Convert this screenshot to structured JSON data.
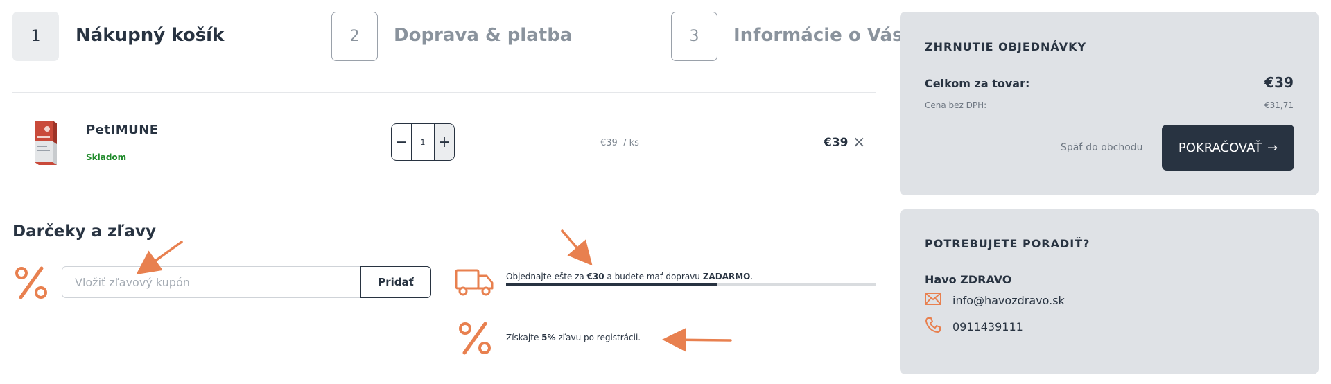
{
  "steps": [
    {
      "number": "1",
      "label": "Nákupný košík"
    },
    {
      "number": "2",
      "label": "Doprava & platba"
    },
    {
      "number": "3",
      "label": "Informácie o Vás"
    }
  ],
  "cart": {
    "item": {
      "name": "PetIMUNE",
      "stock": "Skladom",
      "quantity": "1",
      "unit_price": "€39",
      "unit": "/ ks",
      "total": "€39"
    }
  },
  "gifts": {
    "title": "Darčeky a zľavy",
    "coupon_placeholder": "Vložiť zľavový kupón",
    "coupon_button": "Pridať",
    "shipping": {
      "prefix": "Objednajte ešte za ",
      "amount": "€30",
      "middle": " a budete mať dopravu ",
      "free": "ZADARMO",
      "suffix": ".",
      "progress": 0.57
    },
    "registration": {
      "prefix": "Získajte ",
      "percent": "5%",
      "suffix": " zľavu po registrácii."
    }
  },
  "summary": {
    "title": "ZHRNUTIE OBJEDNÁVKY",
    "total_label": "Celkom za tovar:",
    "total_value": "€39",
    "novat_label": "Cena bez DPH:",
    "novat_value": "€31,71",
    "back_label": "Späť do obchodu",
    "continue_label": "POKRAČOVAŤ"
  },
  "help": {
    "title": "POTREBUJETE PORADIŤ?",
    "company": "Havo ZDRAVO",
    "email": "info@havozdravo.sk",
    "phone": "0911439111"
  },
  "colors": {
    "accent": "#e8804f",
    "dark": "#283341",
    "in_stock": "#1f8a2a",
    "panel": "#dfe2e6"
  },
  "icons": [
    "percent-icon",
    "truck-icon",
    "minus-icon",
    "plus-icon",
    "close-icon",
    "arrow-right-icon",
    "mail-icon",
    "phone-icon"
  ]
}
